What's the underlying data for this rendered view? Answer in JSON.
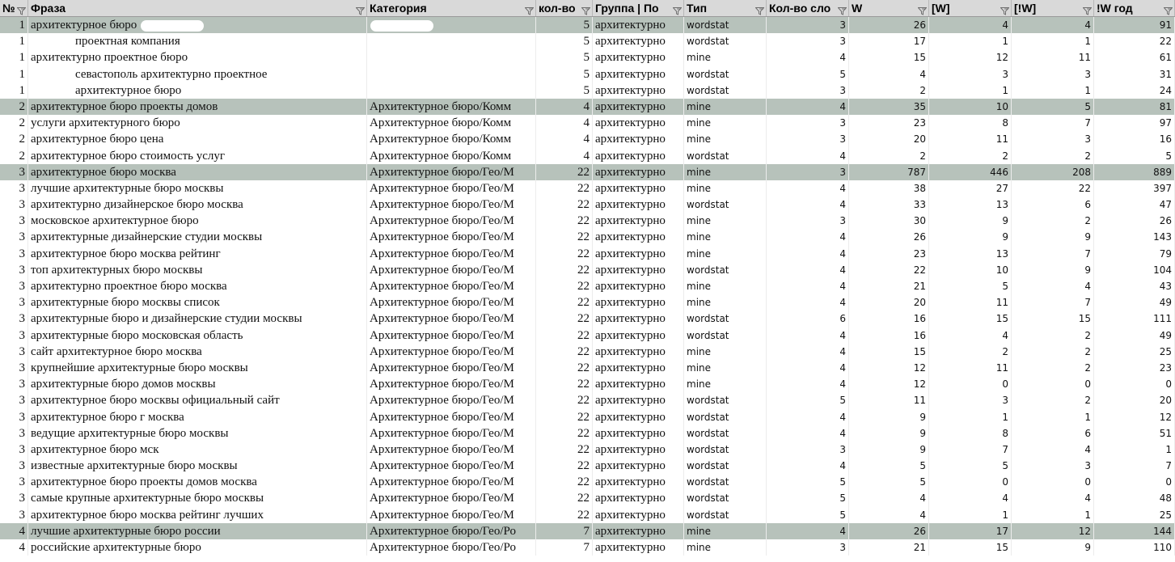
{
  "columns": [
    {
      "key": "n",
      "label": "№"
    },
    {
      "key": "phrase",
      "label": "Фраза"
    },
    {
      "key": "category",
      "label": "Категория"
    },
    {
      "key": "count",
      "label": "кол-во"
    },
    {
      "key": "group",
      "label": "Группа | По"
    },
    {
      "key": "type",
      "label": "Тип"
    },
    {
      "key": "words",
      "label": "Кол-во сло"
    },
    {
      "key": "w",
      "label": "W"
    },
    {
      "key": "wb",
      "label": "[W]"
    },
    {
      "key": "wbx",
      "label": "[!W]"
    },
    {
      "key": "wyear",
      "label": "!W год"
    }
  ],
  "rows": [
    {
      "n": "1",
      "phrase": "архитектурное бюро",
      "category": "",
      "count": "5",
      "group": "архитектурно",
      "type": "wordstat",
      "words": "3",
      "w": "26",
      "wb": "4",
      "wbx": "4",
      "wyear": "91",
      "hl": true,
      "redact_phrase": true,
      "redact_cat": true
    },
    {
      "n": "1",
      "phrase": "проектная компания",
      "category": "",
      "count": "5",
      "group": "архитектурно",
      "type": "wordstat",
      "words": "3",
      "w": "17",
      "wb": "1",
      "wbx": "1",
      "wyear": "22",
      "indent": true
    },
    {
      "n": "1",
      "phrase": "архитектурно проектное бюро",
      "category": "",
      "count": "5",
      "group": "архитектурно",
      "type": "mine",
      "words": "4",
      "w": "15",
      "wb": "12",
      "wbx": "11",
      "wyear": "61"
    },
    {
      "n": "1",
      "phrase": "севастополь архитектурно проектное",
      "category": "",
      "count": "5",
      "group": "архитектурно",
      "type": "wordstat",
      "words": "5",
      "w": "4",
      "wb": "3",
      "wbx": "3",
      "wyear": "31",
      "indent": true,
      "redact_line": true
    },
    {
      "n": "1",
      "phrase": "архитектурное бюро",
      "category": "",
      "count": "5",
      "group": "архитектурно",
      "type": "wordstat",
      "words": "3",
      "w": "2",
      "wb": "1",
      "wbx": "1",
      "wyear": "24",
      "indent": true
    },
    {
      "n": "2",
      "phrase": "архитектурное бюро проекты домов",
      "category": "Архитектурное бюро/Комм",
      "count": "4",
      "group": "архитектурно",
      "type": "mine",
      "words": "4",
      "w": "35",
      "wb": "10",
      "wbx": "5",
      "wyear": "81",
      "hl": true
    },
    {
      "n": "2",
      "phrase": "услуги архитектурного бюро",
      "category": "Архитектурное бюро/Комм",
      "count": "4",
      "group": "архитектурно",
      "type": "mine",
      "words": "3",
      "w": "23",
      "wb": "8",
      "wbx": "7",
      "wyear": "97"
    },
    {
      "n": "2",
      "phrase": "архитектурное бюро цена",
      "category": "Архитектурное бюро/Комм",
      "count": "4",
      "group": "архитектурно",
      "type": "mine",
      "words": "3",
      "w": "20",
      "wb": "11",
      "wbx": "3",
      "wyear": "16"
    },
    {
      "n": "2",
      "phrase": "архитектурное бюро стоимость услуг",
      "category": "Архитектурное бюро/Комм",
      "count": "4",
      "group": "архитектурно",
      "type": "wordstat",
      "words": "4",
      "w": "2",
      "wb": "2",
      "wbx": "2",
      "wyear": "5"
    },
    {
      "n": "3",
      "phrase": "архитектурное бюро москва",
      "category": "Архитектурное бюро/Гео/М",
      "count": "22",
      "group": "архитектурно",
      "type": "mine",
      "words": "3",
      "w": "787",
      "wb": "446",
      "wbx": "208",
      "wyear": "889",
      "hl": true
    },
    {
      "n": "3",
      "phrase": "лучшие архитектурные бюро москвы",
      "category": "Архитектурное бюро/Гео/М",
      "count": "22",
      "group": "архитектурно",
      "type": "mine",
      "words": "4",
      "w": "38",
      "wb": "27",
      "wbx": "22",
      "wyear": "397"
    },
    {
      "n": "3",
      "phrase": "архитектурно дизайнерское бюро москва",
      "category": "Архитектурное бюро/Гео/М",
      "count": "22",
      "group": "архитектурно",
      "type": "wordstat",
      "words": "4",
      "w": "33",
      "wb": "13",
      "wbx": "6",
      "wyear": "47"
    },
    {
      "n": "3",
      "phrase": "московское архитектурное бюро",
      "category": "Архитектурное бюро/Гео/М",
      "count": "22",
      "group": "архитектурно",
      "type": "mine",
      "words": "3",
      "w": "30",
      "wb": "9",
      "wbx": "2",
      "wyear": "26"
    },
    {
      "n": "3",
      "phrase": "архитектурные дизайнерские студии москвы",
      "category": "Архитектурное бюро/Гео/М",
      "count": "22",
      "group": "архитектурно",
      "type": "mine",
      "words": "4",
      "w": "26",
      "wb": "9",
      "wbx": "9",
      "wyear": "143"
    },
    {
      "n": "3",
      "phrase": "архитектурное бюро москва рейтинг",
      "category": "Архитектурное бюро/Гео/М",
      "count": "22",
      "group": "архитектурно",
      "type": "mine",
      "words": "4",
      "w": "23",
      "wb": "13",
      "wbx": "7",
      "wyear": "79"
    },
    {
      "n": "3",
      "phrase": "топ архитектурных бюро москвы",
      "category": "Архитектурное бюро/Гео/М",
      "count": "22",
      "group": "архитектурно",
      "type": "wordstat",
      "words": "4",
      "w": "22",
      "wb": "10",
      "wbx": "9",
      "wyear": "104"
    },
    {
      "n": "3",
      "phrase": "архитектурно проектное бюро москва",
      "category": "Архитектурное бюро/Гео/М",
      "count": "22",
      "group": "архитектурно",
      "type": "mine",
      "words": "4",
      "w": "21",
      "wb": "5",
      "wbx": "4",
      "wyear": "43"
    },
    {
      "n": "3",
      "phrase": "архитектурные бюро москвы список",
      "category": "Архитектурное бюро/Гео/М",
      "count": "22",
      "group": "архитектурно",
      "type": "mine",
      "words": "4",
      "w": "20",
      "wb": "11",
      "wbx": "7",
      "wyear": "49"
    },
    {
      "n": "3",
      "phrase": "архитектурные бюро и дизайнерские студии москвы",
      "category": "Архитектурное бюро/Гео/М",
      "count": "22",
      "group": "архитектурно",
      "type": "wordstat",
      "words": "6",
      "w": "16",
      "wb": "15",
      "wbx": "15",
      "wyear": "111"
    },
    {
      "n": "3",
      "phrase": "архитектурные бюро московская область",
      "category": "Архитектурное бюро/Гео/М",
      "count": "22",
      "group": "архитектурно",
      "type": "wordstat",
      "words": "4",
      "w": "16",
      "wb": "4",
      "wbx": "2",
      "wyear": "49"
    },
    {
      "n": "3",
      "phrase": "сайт архитектурное бюро москва",
      "category": "Архитектурное бюро/Гео/М",
      "count": "22",
      "group": "архитектурно",
      "type": "mine",
      "words": "4",
      "w": "15",
      "wb": "2",
      "wbx": "2",
      "wyear": "25"
    },
    {
      "n": "3",
      "phrase": "крупнейшие архитектурные бюро москвы",
      "category": "Архитектурное бюро/Гео/М",
      "count": "22",
      "group": "архитектурно",
      "type": "mine",
      "words": "4",
      "w": "12",
      "wb": "11",
      "wbx": "2",
      "wyear": "23"
    },
    {
      "n": "3",
      "phrase": "архитектурные бюро домов москвы",
      "category": "Архитектурное бюро/Гео/М",
      "count": "22",
      "group": "архитектурно",
      "type": "mine",
      "words": "4",
      "w": "12",
      "wb": "0",
      "wbx": "0",
      "wyear": "0"
    },
    {
      "n": "3",
      "phrase": "архитектурное бюро москвы официальный сайт",
      "category": "Архитектурное бюро/Гео/М",
      "count": "22",
      "group": "архитектурно",
      "type": "wordstat",
      "words": "5",
      "w": "11",
      "wb": "3",
      "wbx": "2",
      "wyear": "20"
    },
    {
      "n": "3",
      "phrase": "архитектурное бюро г москва",
      "category": "Архитектурное бюро/Гео/М",
      "count": "22",
      "group": "архитектурно",
      "type": "wordstat",
      "words": "4",
      "w": "9",
      "wb": "1",
      "wbx": "1",
      "wyear": "12"
    },
    {
      "n": "3",
      "phrase": "ведущие архитектурные бюро москвы",
      "category": "Архитектурное бюро/Гео/М",
      "count": "22",
      "group": "архитектурно",
      "type": "wordstat",
      "words": "4",
      "w": "9",
      "wb": "8",
      "wbx": "6",
      "wyear": "51"
    },
    {
      "n": "3",
      "phrase": "архитектурное бюро мск",
      "category": "Архитектурное бюро/Гео/М",
      "count": "22",
      "group": "архитектурно",
      "type": "wordstat",
      "words": "3",
      "w": "9",
      "wb": "7",
      "wbx": "4",
      "wyear": "1"
    },
    {
      "n": "3",
      "phrase": "известные архитектурные бюро москвы",
      "category": "Архитектурное бюро/Гео/М",
      "count": "22",
      "group": "архитектурно",
      "type": "wordstat",
      "words": "4",
      "w": "5",
      "wb": "5",
      "wbx": "3",
      "wyear": "7"
    },
    {
      "n": "3",
      "phrase": "архитектурное бюро проекты домов москва",
      "category": "Архитектурное бюро/Гео/М",
      "count": "22",
      "group": "архитектурно",
      "type": "wordstat",
      "words": "5",
      "w": "5",
      "wb": "0",
      "wbx": "0",
      "wyear": "0"
    },
    {
      "n": "3",
      "phrase": "самые крупные архитектурные бюро москвы",
      "category": "Архитектурное бюро/Гео/М",
      "count": "22",
      "group": "архитектурно",
      "type": "wordstat",
      "words": "5",
      "w": "4",
      "wb": "4",
      "wbx": "4",
      "wyear": "48"
    },
    {
      "n": "3",
      "phrase": "архитектурное бюро москва рейтинг лучших",
      "category": "Архитектурное бюро/Гео/М",
      "count": "22",
      "group": "архитектурно",
      "type": "wordstat",
      "words": "5",
      "w": "4",
      "wb": "1",
      "wbx": "1",
      "wyear": "25"
    },
    {
      "n": "4",
      "phrase": "лучшие архитектурные бюро россии",
      "category": "Архитектурное бюро/Гео/Ро",
      "count": "7",
      "group": "архитектурно",
      "type": "mine",
      "words": "4",
      "w": "26",
      "wb": "17",
      "wbx": "12",
      "wyear": "144",
      "hl": true
    },
    {
      "n": "4",
      "phrase": "российские архитектурные бюро",
      "category": "Архитектурное бюро/Гео/Ро",
      "count": "7",
      "group": "архитектурно",
      "type": "mine",
      "words": "3",
      "w": "21",
      "wb": "15",
      "wbx": "9",
      "wyear": "110"
    }
  ],
  "colors": {
    "header": "#d9d9d9",
    "highlight": "#b7c2bb",
    "grid": "#ececec"
  },
  "icons": {
    "filter": "filter-icon"
  }
}
